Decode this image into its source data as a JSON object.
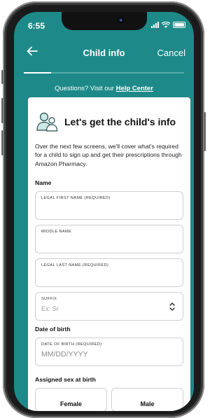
{
  "status": {
    "time": "6:55"
  },
  "nav": {
    "title": "Child info",
    "cancel_label": "Cancel"
  },
  "progress": {
    "fraction": 0.17
  },
  "help": {
    "prefix": "Questions? Visit our ",
    "link": "Help Center"
  },
  "card": {
    "title": "Let's get the child's info",
    "intro": "Over the next few screens, we'll cover what's required for a child to sign up and get their prescriptions through Amazon Pharmacy.",
    "name_section": "Name",
    "fields": {
      "first": {
        "label": "LEGAL FIRST NAME (REQUIRED)",
        "value": ""
      },
      "middle": {
        "label": "MIDDLE NAME",
        "value": ""
      },
      "last": {
        "label": "LEGAL LAST NAME (REQUIRED)",
        "value": ""
      },
      "suffix": {
        "label": "SUFFIX",
        "placeholder": "Ex: Sr"
      }
    },
    "dob_section": "Date of birth",
    "dob": {
      "label": "DATE OF BIRTH (REQUIRED)",
      "placeholder": "MM/DD/YYYY"
    },
    "sex_section": "Assigned sex at birth",
    "sex_options": [
      "Female",
      "Male"
    ]
  },
  "icons": {
    "back": "arrow-left-icon",
    "family": "family-icon",
    "suffix_select": "chevron-up-down-icon"
  },
  "colors": {
    "teal": "#1d8a89",
    "card": "#ffffff"
  }
}
